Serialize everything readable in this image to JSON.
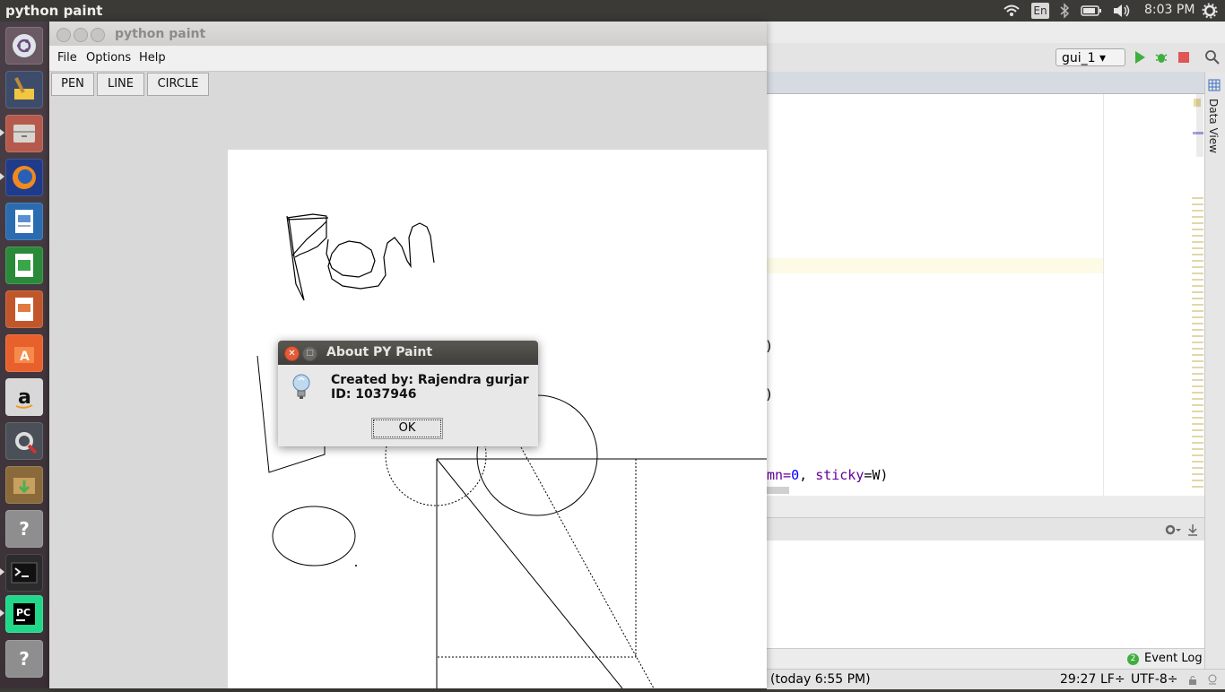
{
  "topbar": {
    "app_title": "python paint",
    "keyboard_layout": "En",
    "clock": "8:03 PM"
  },
  "launcher": {
    "items": [
      "ubuntu-dash-icon",
      "cleaner-icon",
      "files-icon",
      "firefox-icon",
      "writer-icon",
      "calc-icon",
      "impress-icon",
      "software-center-icon",
      "amazon-icon",
      "settings-icon",
      "archive-manager-icon",
      "unknown-app-icon",
      "terminal-icon",
      "pycharm-icon",
      "unknown-app-icon",
      "trash-icon"
    ]
  },
  "ide": {
    "run_config": "gui_1",
    "data_view": "Data View",
    "code_line_1": ")",
    "code_line_2": ")",
    "code_line_3_prefix": "mn=",
    "code_line_3_num": "0",
    "code_line_3_sep": ", ",
    "code_line_3_kw": "sticky",
    "code_line_3_rest": "=W)",
    "event_log": "Event Log",
    "event_log_count": "2",
    "status_time": "(today 6:55 PM)",
    "status_position": "29:27",
    "status_line_sep": "LF÷",
    "status_encoding": "UTF-8÷"
  },
  "paint": {
    "window_title": "python paint",
    "menu": [
      "File",
      "Options",
      "Help"
    ],
    "tools": [
      "PEN",
      "LINE",
      "CIRCLE"
    ]
  },
  "dialog": {
    "title": "About PY Paint",
    "line1": "Created by: Rajendra gurjar",
    "line2": "ID: 1037946",
    "ok": "OK"
  },
  "colors": {
    "ubuntu_panel": "#3b3a36",
    "dialog_close": "#e25b3b",
    "pycharm_green": "#21d789",
    "run_green": "#3fae3f"
  }
}
